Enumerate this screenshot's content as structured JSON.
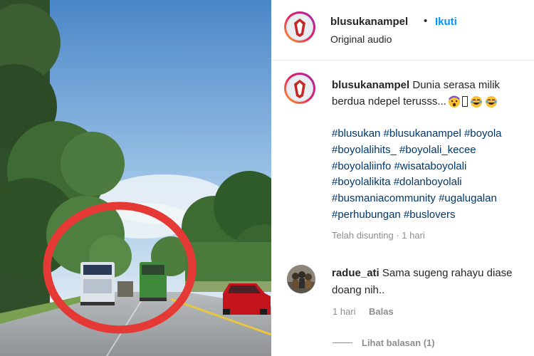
{
  "post": {
    "username": "blusukanampel",
    "separator": "•",
    "follow_label": "Ikuti",
    "audio": "Original audio"
  },
  "caption": {
    "username": "blusukanampel",
    "line1": "Dunia serasa milik",
    "line2_text": "berdua ndepel terusss...",
    "hashtag_lines": [
      "#blusukan #blusukanampel #boyola",
      "#boyolalihits_ #boyolali_kecee",
      "#boyolaliinfo #wisataboyolali",
      "#boyolalikita #dolanboyolali",
      "#busmaniacommunity #ugalugalan",
      "#perhubungan #buslovers"
    ],
    "edited": "Telah disunting · 1 hari",
    "emoji_icons": [
      "fearful-face-icon",
      "unknown-glyph-icon",
      "laughing-face-icon",
      "laughing-face-icon"
    ]
  },
  "comment": {
    "username": "radue_ati",
    "line1": "Sama sugeng rahayu diase",
    "line2": "doang nih..",
    "time": "1 hari",
    "reply_label": "Balas",
    "view_replies": "Lihat balasan (1)"
  },
  "colors": {
    "follow": "#0095f6",
    "hashtag": "#00376b",
    "meta": "#8e8e8e",
    "highlight_circle": "#e53935"
  }
}
